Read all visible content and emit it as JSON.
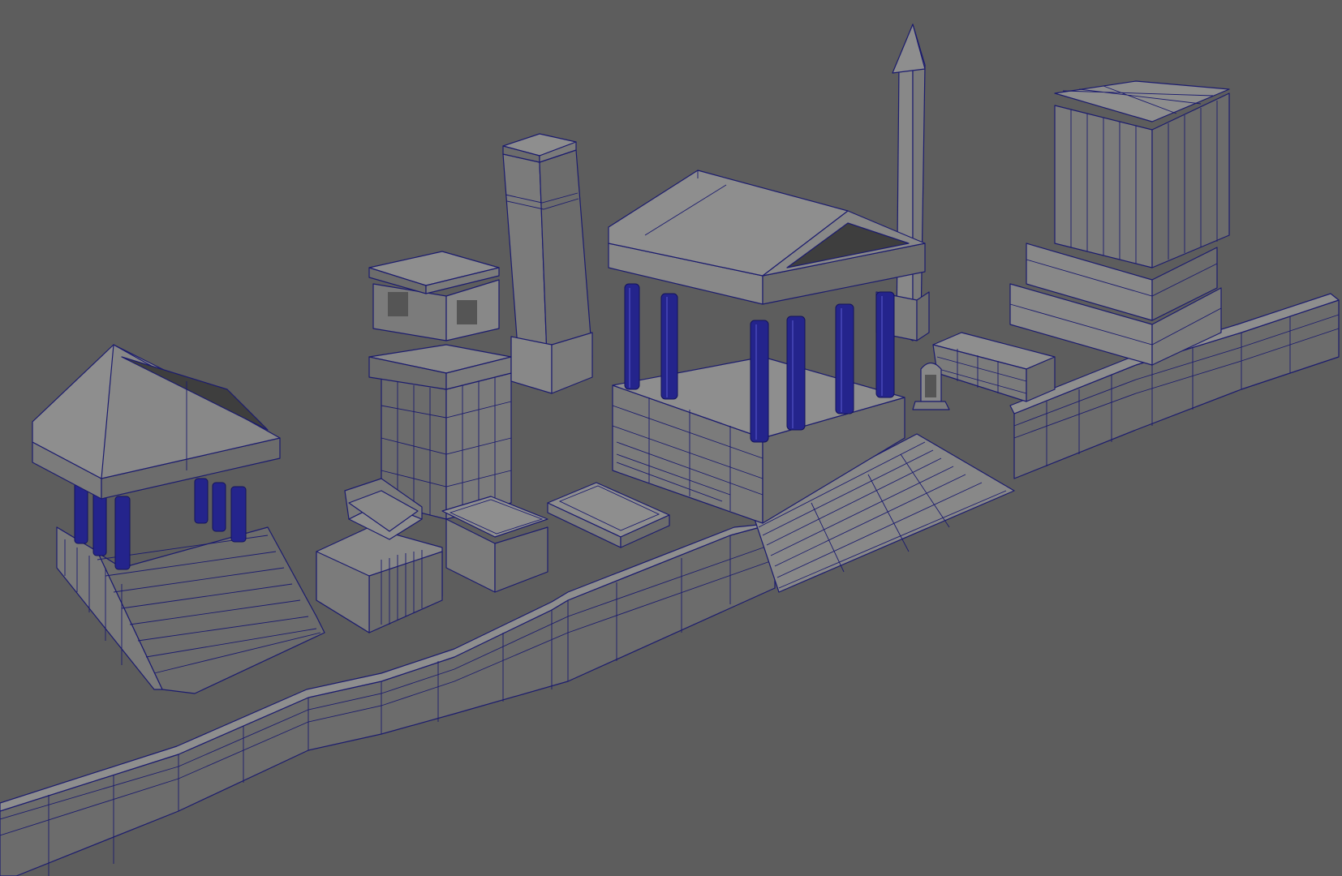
{
  "viewport": {
    "background": "#5d5d5d",
    "wireframe_color": "#1c1c6e",
    "column_color": "#24248c",
    "shading": "wireframe-on-shaded"
  },
  "scene_objects": [
    "temple-left",
    "tower",
    "pillar-tall",
    "sarcophagus",
    "tomb-box",
    "grave-slab",
    "temple-center",
    "obelisk",
    "block-tower",
    "rubble-block",
    "headstone",
    "wall-front",
    "wall-right"
  ]
}
